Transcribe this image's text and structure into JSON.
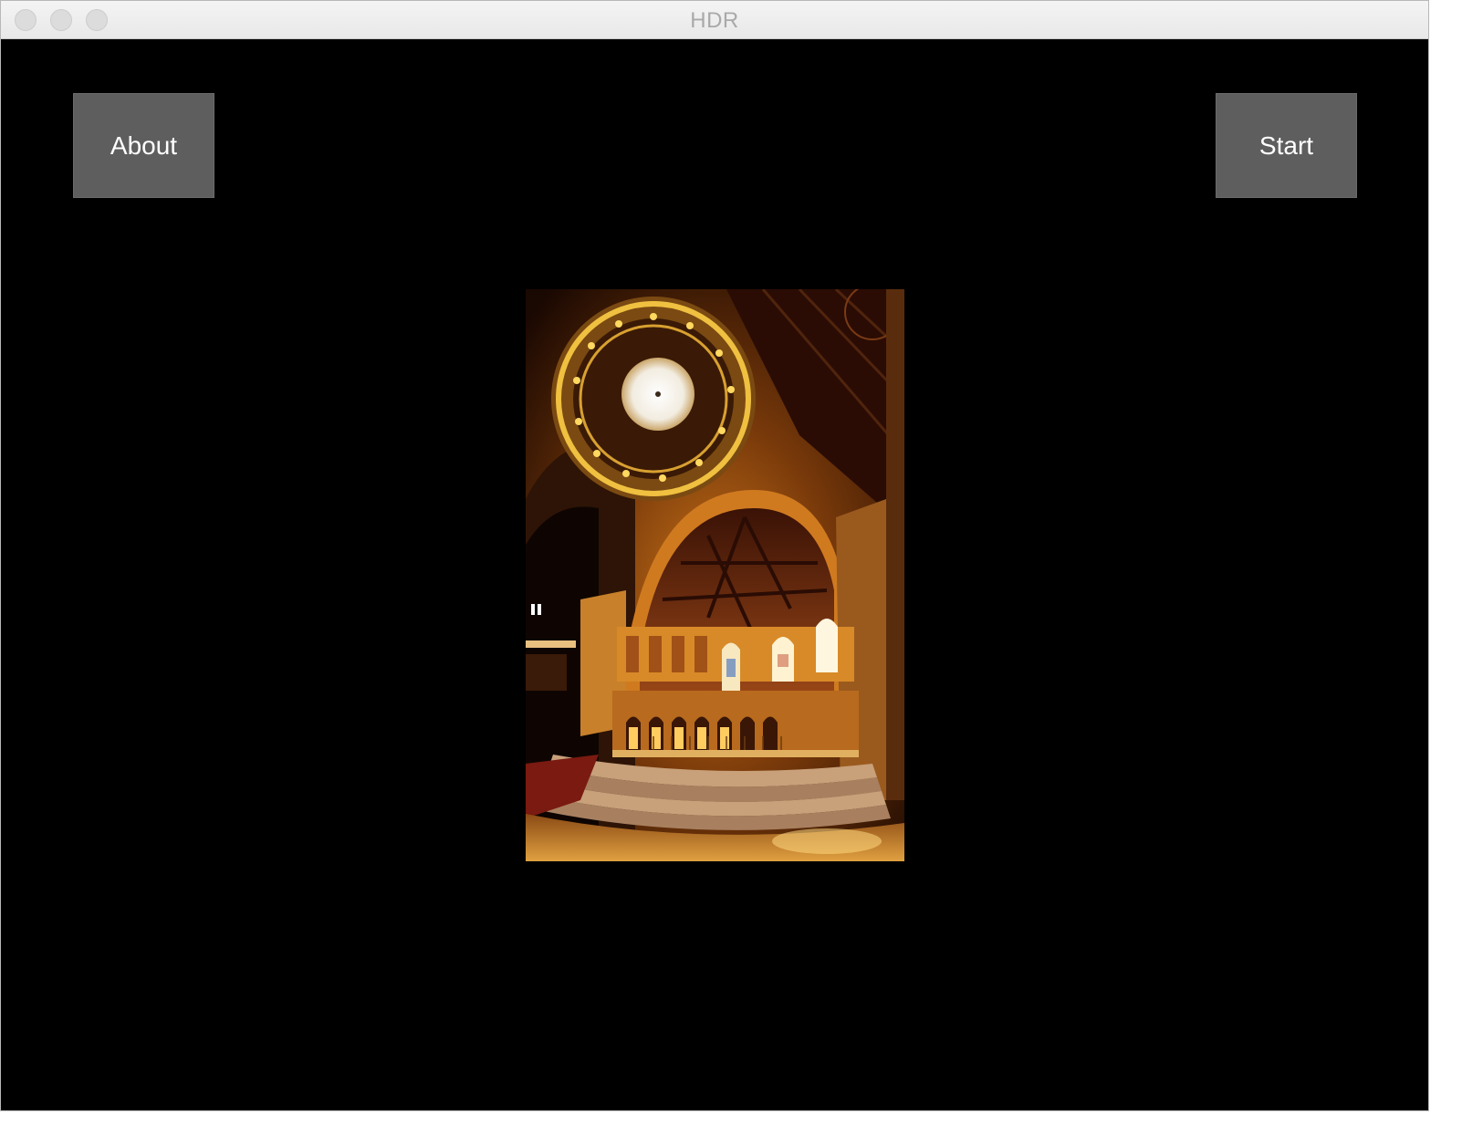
{
  "window": {
    "title": "HDR"
  },
  "toolbar": {
    "about_label": "About",
    "start_label": "Start"
  },
  "image": {
    "subject": "church-interior-dome-photo"
  },
  "colors": {
    "window_bg": "#000000",
    "button_bg": "#5e5e5e",
    "button_text": "#ffffff",
    "title_text": "#a9a9a9"
  }
}
